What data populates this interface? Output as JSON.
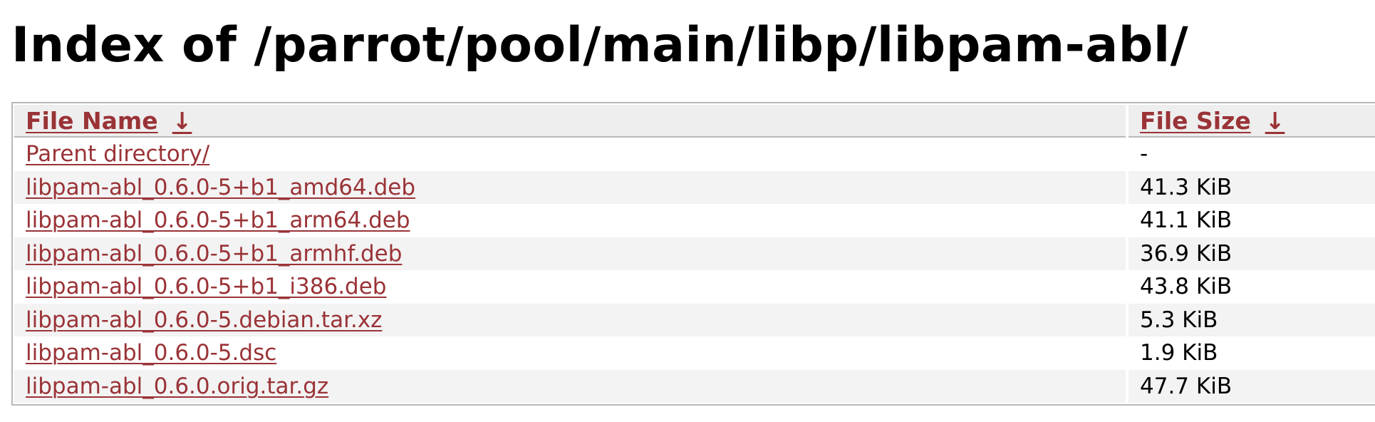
{
  "page": {
    "title": "Index of /parrot/pool/main/libp/libpam-abl/"
  },
  "table": {
    "headers": {
      "name_label": "File Name",
      "name_sort_icon": "↓",
      "size_label": "File Size",
      "size_sort_icon": "↓"
    },
    "rows": [
      {
        "name": "Parent directory/",
        "size": "-"
      },
      {
        "name": "libpam-abl_0.6.0-5+b1_amd64.deb",
        "size": "41.3 KiB"
      },
      {
        "name": "libpam-abl_0.6.0-5+b1_arm64.deb",
        "size": "41.1 KiB"
      },
      {
        "name": "libpam-abl_0.6.0-5+b1_armhf.deb",
        "size": "36.9 KiB"
      },
      {
        "name": "libpam-abl_0.6.0-5+b1_i386.deb",
        "size": "43.8 KiB"
      },
      {
        "name": "libpam-abl_0.6.0-5.debian.tar.xz",
        "size": "5.3 KiB"
      },
      {
        "name": "libpam-abl_0.6.0-5.dsc",
        "size": "1.9 KiB"
      },
      {
        "name": "libpam-abl_0.6.0.orig.tar.gz",
        "size": "47.7 KiB"
      }
    ]
  },
  "icons": {
    "sort_name": "arrow-down-icon",
    "sort_size": "arrow-down-icon"
  },
  "colors": {
    "link": "#9a3337",
    "header_bg": "#eeeeee",
    "row_alt_bg": "#f3f3f3",
    "border": "#b8b8b8"
  }
}
